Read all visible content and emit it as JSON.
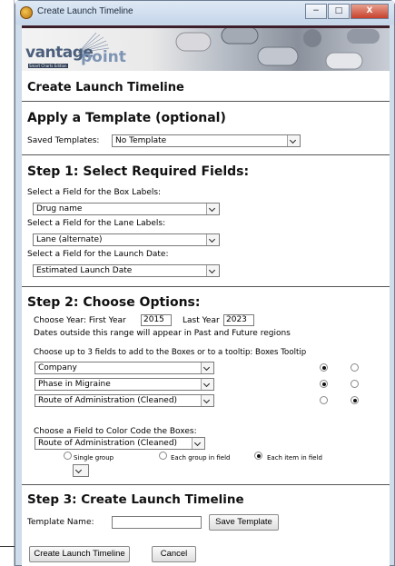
{
  "window": {
    "title": "Create Launch Timeline",
    "controls": {
      "minimize": "−",
      "maximize": "□",
      "close": "X"
    }
  },
  "banner": {
    "logo_main": "vantage",
    "logo_point": "point",
    "logo_sub": "Smart Charts Edition"
  },
  "page": {
    "heading": "Create Launch Timeline"
  },
  "template_section": {
    "heading": "Apply a Template (optional)",
    "saved_label": "Saved Templates:",
    "saved_value": "No Template"
  },
  "step1": {
    "heading": "Step 1: Select Required Fields:",
    "box_label": "Select a Field for the Box Labels:",
    "box_value": "Drug name",
    "lane_label": "Select a Field for the Lane Labels:",
    "lane_value": "Lane (alternate)",
    "date_label": "Select a Field for the Launch Date:",
    "date_value": "Estimated Launch Date"
  },
  "step2": {
    "heading": "Step 2: Choose Options:",
    "year_prefix": "Choose Year: First Year",
    "first_year": "2015",
    "last_year_label": "Last Year",
    "last_year": "2023",
    "range_note": "Dates outside this range will appear in Past and Future regions",
    "fields_label": "Choose up to 3 fields to add to the Boxes or to a tooltip: Boxes Tooltip",
    "fields": [
      {
        "value": "Company",
        "target": "boxes"
      },
      {
        "value": "Phase in Migraine",
        "target": "boxes"
      },
      {
        "value": "Route of Administration (Cleaned)",
        "target": "tooltip"
      }
    ],
    "color_label": "Choose a Field to Color Code the Boxes:",
    "color_value": "Route of Administration (Cleaned)",
    "color_options": {
      "single": "Single group",
      "each_group": "Each group in field",
      "each_item": "Each item in field",
      "selected": "each_item"
    },
    "color_group_value": ""
  },
  "step3": {
    "heading": "Step 3: Create Launch Timeline",
    "template_name_label": "Template Name:",
    "template_name_value": "",
    "save_template": "Save Template",
    "create": "Create Launch Timeline",
    "cancel": "Cancel"
  }
}
